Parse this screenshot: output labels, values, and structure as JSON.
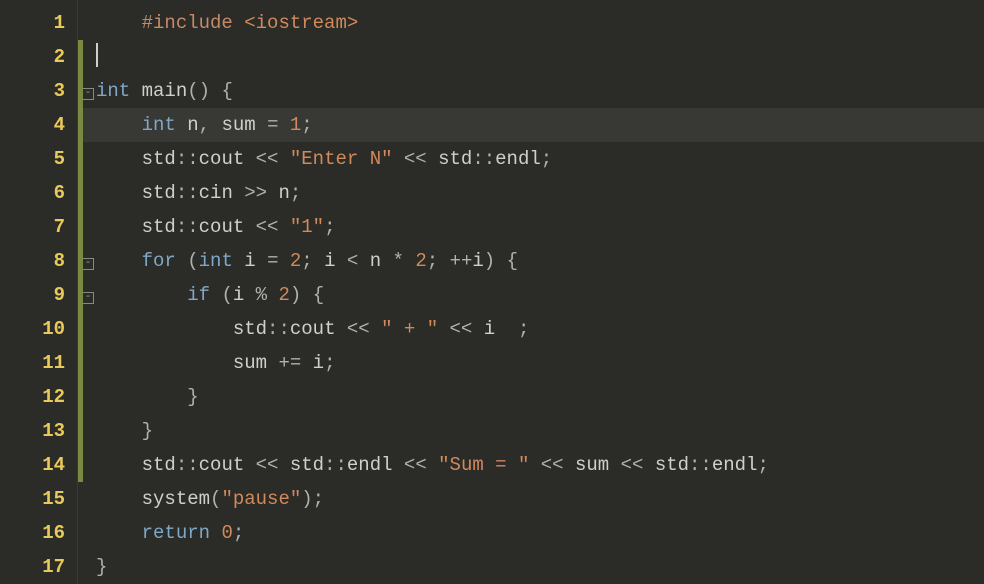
{
  "editor": {
    "lines": [
      {
        "num": 1,
        "marker": false,
        "fold": null,
        "indent": "    ",
        "tokens": [
          {
            "c": "preproc",
            "t": "#include "
          },
          {
            "c": "incname",
            "t": "<iostream>"
          }
        ]
      },
      {
        "num": 2,
        "marker": true,
        "fold": null,
        "indent": "",
        "cursor": true,
        "tokens": []
      },
      {
        "num": 3,
        "marker": true,
        "fold": "minus",
        "indent": "",
        "tokens": [
          {
            "c": "type",
            "t": "int"
          },
          {
            "c": "default",
            "t": " "
          },
          {
            "c": "func",
            "t": "main"
          },
          {
            "c": "punc",
            "t": "()"
          },
          {
            "c": "default",
            "t": " "
          },
          {
            "c": "punc",
            "t": "{"
          }
        ]
      },
      {
        "num": 4,
        "marker": true,
        "fold": null,
        "indent": "    ",
        "highlight": true,
        "tokens": [
          {
            "c": "type",
            "t": "int"
          },
          {
            "c": "default",
            "t": " n"
          },
          {
            "c": "punc",
            "t": ","
          },
          {
            "c": "default",
            "t": " sum "
          },
          {
            "c": "op",
            "t": "="
          },
          {
            "c": "default",
            "t": " "
          },
          {
            "c": "num",
            "t": "1"
          },
          {
            "c": "punc",
            "t": ";"
          }
        ]
      },
      {
        "num": 5,
        "marker": true,
        "fold": null,
        "indent": "    ",
        "tokens": [
          {
            "c": "ident",
            "t": "std"
          },
          {
            "c": "punc",
            "t": "::"
          },
          {
            "c": "member",
            "t": "cout"
          },
          {
            "c": "default",
            "t": " "
          },
          {
            "c": "op",
            "t": "<<"
          },
          {
            "c": "default",
            "t": " "
          },
          {
            "c": "str",
            "t": "\"Enter N\""
          },
          {
            "c": "default",
            "t": " "
          },
          {
            "c": "op",
            "t": "<<"
          },
          {
            "c": "default",
            "t": " "
          },
          {
            "c": "ident",
            "t": "std"
          },
          {
            "c": "punc",
            "t": "::"
          },
          {
            "c": "member",
            "t": "endl"
          },
          {
            "c": "punc",
            "t": ";"
          }
        ]
      },
      {
        "num": 6,
        "marker": true,
        "fold": null,
        "indent": "    ",
        "tokens": [
          {
            "c": "ident",
            "t": "std"
          },
          {
            "c": "punc",
            "t": "::"
          },
          {
            "c": "member",
            "t": "cin"
          },
          {
            "c": "default",
            "t": " "
          },
          {
            "c": "op",
            "t": ">>"
          },
          {
            "c": "default",
            "t": " n"
          },
          {
            "c": "punc",
            "t": ";"
          }
        ]
      },
      {
        "num": 7,
        "marker": true,
        "fold": null,
        "indent": "    ",
        "tokens": [
          {
            "c": "ident",
            "t": "std"
          },
          {
            "c": "punc",
            "t": "::"
          },
          {
            "c": "member",
            "t": "cout"
          },
          {
            "c": "default",
            "t": " "
          },
          {
            "c": "op",
            "t": "<<"
          },
          {
            "c": "default",
            "t": " "
          },
          {
            "c": "str",
            "t": "\"1\""
          },
          {
            "c": "punc",
            "t": ";"
          }
        ]
      },
      {
        "num": 8,
        "marker": true,
        "fold": "minus",
        "indent": "    ",
        "tokens": [
          {
            "c": "keyword",
            "t": "for"
          },
          {
            "c": "default",
            "t": " "
          },
          {
            "c": "punc",
            "t": "("
          },
          {
            "c": "type",
            "t": "int"
          },
          {
            "c": "default",
            "t": " i "
          },
          {
            "c": "op",
            "t": "="
          },
          {
            "c": "default",
            "t": " "
          },
          {
            "c": "num",
            "t": "2"
          },
          {
            "c": "punc",
            "t": ";"
          },
          {
            "c": "default",
            "t": " i "
          },
          {
            "c": "op",
            "t": "<"
          },
          {
            "c": "default",
            "t": " n "
          },
          {
            "c": "op",
            "t": "*"
          },
          {
            "c": "default",
            "t": " "
          },
          {
            "c": "num",
            "t": "2"
          },
          {
            "c": "punc",
            "t": ";"
          },
          {
            "c": "default",
            "t": " "
          },
          {
            "c": "op",
            "t": "++"
          },
          {
            "c": "default",
            "t": "i"
          },
          {
            "c": "punc",
            "t": ")"
          },
          {
            "c": "default",
            "t": " "
          },
          {
            "c": "punc",
            "t": "{"
          }
        ]
      },
      {
        "num": 9,
        "marker": true,
        "fold": "minus",
        "indent": "        ",
        "tokens": [
          {
            "c": "keyword",
            "t": "if"
          },
          {
            "c": "default",
            "t": " "
          },
          {
            "c": "punc",
            "t": "("
          },
          {
            "c": "default",
            "t": "i "
          },
          {
            "c": "op",
            "t": "%"
          },
          {
            "c": "default",
            "t": " "
          },
          {
            "c": "num",
            "t": "2"
          },
          {
            "c": "punc",
            "t": ")"
          },
          {
            "c": "default",
            "t": " "
          },
          {
            "c": "punc",
            "t": "{"
          }
        ]
      },
      {
        "num": 10,
        "marker": true,
        "fold": null,
        "indent": "            ",
        "tokens": [
          {
            "c": "ident",
            "t": "std"
          },
          {
            "c": "punc",
            "t": "::"
          },
          {
            "c": "member",
            "t": "cout"
          },
          {
            "c": "default",
            "t": " "
          },
          {
            "c": "op",
            "t": "<<"
          },
          {
            "c": "default",
            "t": " "
          },
          {
            "c": "str",
            "t": "\" + \""
          },
          {
            "c": "default",
            "t": " "
          },
          {
            "c": "op",
            "t": "<<"
          },
          {
            "c": "default",
            "t": " i  "
          },
          {
            "c": "punc",
            "t": ";"
          }
        ]
      },
      {
        "num": 11,
        "marker": true,
        "fold": null,
        "indent": "            ",
        "tokens": [
          {
            "c": "default",
            "t": "sum "
          },
          {
            "c": "op",
            "t": "+="
          },
          {
            "c": "default",
            "t": " i"
          },
          {
            "c": "punc",
            "t": ";"
          }
        ]
      },
      {
        "num": 12,
        "marker": true,
        "fold": null,
        "indent": "        ",
        "tokens": [
          {
            "c": "punc",
            "t": "}"
          }
        ]
      },
      {
        "num": 13,
        "marker": true,
        "fold": null,
        "indent": "    ",
        "tokens": [
          {
            "c": "punc",
            "t": "}"
          }
        ]
      },
      {
        "num": 14,
        "marker": true,
        "fold": null,
        "indent": "    ",
        "tokens": [
          {
            "c": "ident",
            "t": "std"
          },
          {
            "c": "punc",
            "t": "::"
          },
          {
            "c": "member",
            "t": "cout"
          },
          {
            "c": "default",
            "t": " "
          },
          {
            "c": "op",
            "t": "<<"
          },
          {
            "c": "default",
            "t": " "
          },
          {
            "c": "ident",
            "t": "std"
          },
          {
            "c": "punc",
            "t": "::"
          },
          {
            "c": "member",
            "t": "endl"
          },
          {
            "c": "default",
            "t": " "
          },
          {
            "c": "op",
            "t": "<<"
          },
          {
            "c": "default",
            "t": " "
          },
          {
            "c": "str",
            "t": "\"Sum = \""
          },
          {
            "c": "default",
            "t": " "
          },
          {
            "c": "op",
            "t": "<<"
          },
          {
            "c": "default",
            "t": " sum "
          },
          {
            "c": "op",
            "t": "<<"
          },
          {
            "c": "default",
            "t": " "
          },
          {
            "c": "ident",
            "t": "std"
          },
          {
            "c": "punc",
            "t": "::"
          },
          {
            "c": "member",
            "t": "endl"
          },
          {
            "c": "punc",
            "t": ";"
          }
        ]
      },
      {
        "num": 15,
        "marker": false,
        "fold": null,
        "indent": "    ",
        "tokens": [
          {
            "c": "func",
            "t": "system"
          },
          {
            "c": "punc",
            "t": "("
          },
          {
            "c": "str",
            "t": "\"pause\""
          },
          {
            "c": "punc",
            "t": ")"
          },
          {
            "c": "punc",
            "t": ";"
          }
        ]
      },
      {
        "num": 16,
        "marker": false,
        "fold": null,
        "indent": "    ",
        "tokens": [
          {
            "c": "keyword",
            "t": "return"
          },
          {
            "c": "default",
            "t": " "
          },
          {
            "c": "num",
            "t": "0"
          },
          {
            "c": "punc",
            "t": ";"
          }
        ]
      },
      {
        "num": 17,
        "marker": false,
        "fold": null,
        "indent": "",
        "tokens": [
          {
            "c": "punc",
            "t": "}"
          }
        ]
      }
    ]
  }
}
